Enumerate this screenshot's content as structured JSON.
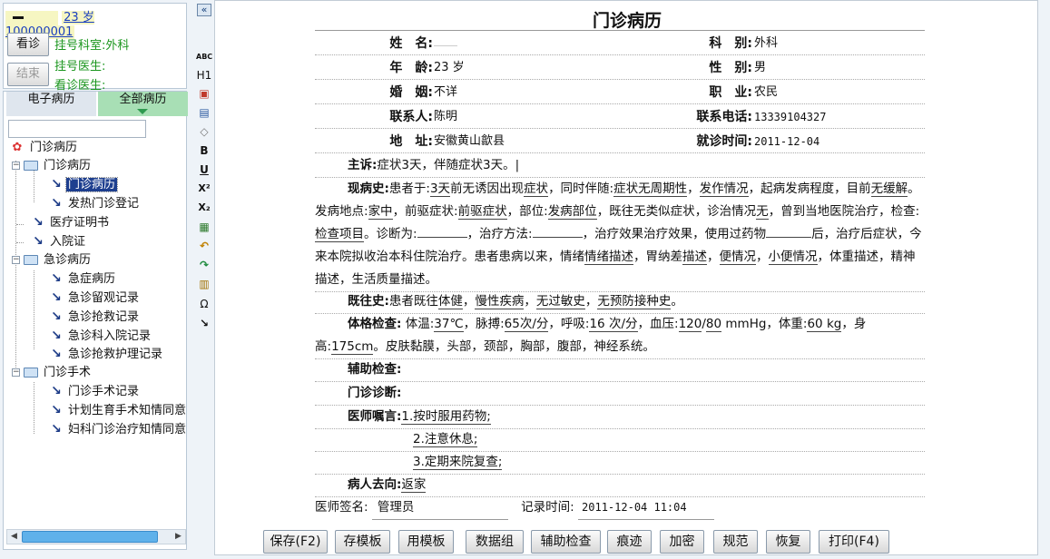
{
  "patient": {
    "info": "23 岁 100000001",
    "registered_dept": "挂号科室:外科",
    "registered_doctor": "挂号医生:",
    "seeing_doctor": "看诊医生:"
  },
  "actions": {
    "see": "看诊",
    "end": "结束"
  },
  "tabs": {
    "emr": "电子病历",
    "all": "全部病历"
  },
  "tree": {
    "root": "门诊病历",
    "n1": "门诊病历",
    "n1_1": "门诊病历",
    "n1_2": "发热门诊登记",
    "n2": "医疗证明书",
    "n3": "入院证",
    "n4": "急诊病历",
    "n4_1": "急症病历",
    "n4_2": "急诊留观记录",
    "n4_3": "急诊抢救记录",
    "n4_4": "急诊科入院记录",
    "n4_5": "急诊抢救护理记录",
    "n5": "门诊手术",
    "n5_1": "门诊手术记录",
    "n5_2": "计划生育手术知情同意",
    "n5_3": "妇科门诊治疗知情同意"
  },
  "toolbar": {
    "collapse": "«",
    "t1": "ABC",
    "t2": "H1",
    "t3": "▣",
    "t4": "▤",
    "t5": "◇",
    "t6": "B",
    "t7": "U",
    "t8": "X²",
    "t9": "X₂",
    "t10": "▦",
    "t11": "↶",
    "t12": "↷",
    "t13": "▥",
    "t14": "Ω",
    "t15": "↘"
  },
  "doc": {
    "title": "门诊病历",
    "header": {
      "name_label": "姓　名:",
      "name": "",
      "dept_label": "科　别:",
      "dept": "外科",
      "age_label": "年　龄:",
      "age": "23 岁",
      "sex_label": "性　别:",
      "sex": "男",
      "marriage_label": "婚　姻:",
      "marriage": "不详",
      "job_label": "职　业:",
      "job": "农民",
      "contact_label": "联系人:",
      "contact": "陈明",
      "phone_label": "联系电话:",
      "phone": "13339104327",
      "address_label": "地　址:",
      "address": "安徽黄山歙县",
      "visit_label": "就诊时间:",
      "visit": "2011-12-04"
    },
    "complaint_label": "主诉:",
    "complaint": "症状3天，伴随症状3天。|",
    "hpi": {
      "label": "现病史:",
      "t1": "患者于:",
      "onset": "3天",
      "t2": "前无诱因出现",
      "symptom": "症状",
      "t3": "，同时伴随:",
      "accompany": "症状无周期性",
      "t4": "，",
      "development": "发作情况",
      "t5": "，起病发病程度",
      "t6": "，目前",
      "remission": "无缓解",
      "t7": "。 发病地点:",
      "location": "家中",
      "t8": "，前驱症状:",
      "prodrome": "前驱症状",
      "t9": "，部位:",
      "site": "发病部位",
      "t10": "，既往无",
      "t11": "类似症状",
      "t12": "，诊治情况",
      "none": "无",
      "t13": "，曾到当地医院",
      "t14": "治疗，检查:",
      "exam": "检查项目",
      "t15": "。诊断为:",
      "t16": "，治疗方法:",
      "t17": "，治疗效果治疗效果，使用过药物",
      "t18": "后，治疗后症状",
      "t19": "，今来本院拟收治本科住院治疗。患者患病以来，情绪",
      "mood": "情绪描述",
      "t20": "，胃纳差",
      "appetite": "描述",
      "t21": "，",
      "stool": "便情况",
      "t22": "，",
      "urine": "小便情况",
      "t23": "，体重描述，精神描述，生活质量描述。"
    },
    "pmh": {
      "label": "既往史:",
      "t1": "患者既往",
      "health": "体健",
      "t2": "，",
      "chronic": "慢性疾病",
      "t3": "，",
      "allergy": "无过敏史",
      "t4": "，",
      "vacc": "无预防接种史",
      "t5": "。"
    },
    "pe": {
      "label": "体格检查:",
      "t1": "体温:",
      "temp": "37℃",
      "t2": "，脉搏:",
      "pulse": "65次/分",
      "t3": "，呼吸:",
      "resp": "16 次/分",
      "t4": "，血压:",
      "bp_s": "120",
      "slash": "/",
      "bp_d": "80",
      "t5": "mmHg，体重:",
      "weight": "60 kg",
      "t6": "，身高:",
      "height": "175cm",
      "t7": "。皮肤黏膜",
      "t8": "，头部",
      "t9": "，颈部",
      "t10": "，",
      "t11": "胸部",
      "t12": "，腹部",
      "t13": "，神经系统。"
    },
    "aux_label": "辅助检查:",
    "dx_label": "门诊诊断:",
    "advice_label": "医师嘱言:",
    "advice": [
      "1.按时服用药物;",
      "2.注意休息;",
      "3.定期来院复查;"
    ],
    "dest_label": "病人去向:",
    "dest": "返家",
    "sign_label": "医师签名:",
    "sign": "管理员",
    "rec_label": "记录时间:",
    "rec_time": "2011-12-04 11:04"
  },
  "buttons": {
    "save": "保存(F2)",
    "save_tpl": "存模板",
    "use_tpl": "用模板",
    "datagroup": "数据组",
    "aux": "辅助检查",
    "trace": "痕迹",
    "encrypt": "加密",
    "norm": "规范",
    "restore": "恢复",
    "print": "打印(F4)"
  }
}
